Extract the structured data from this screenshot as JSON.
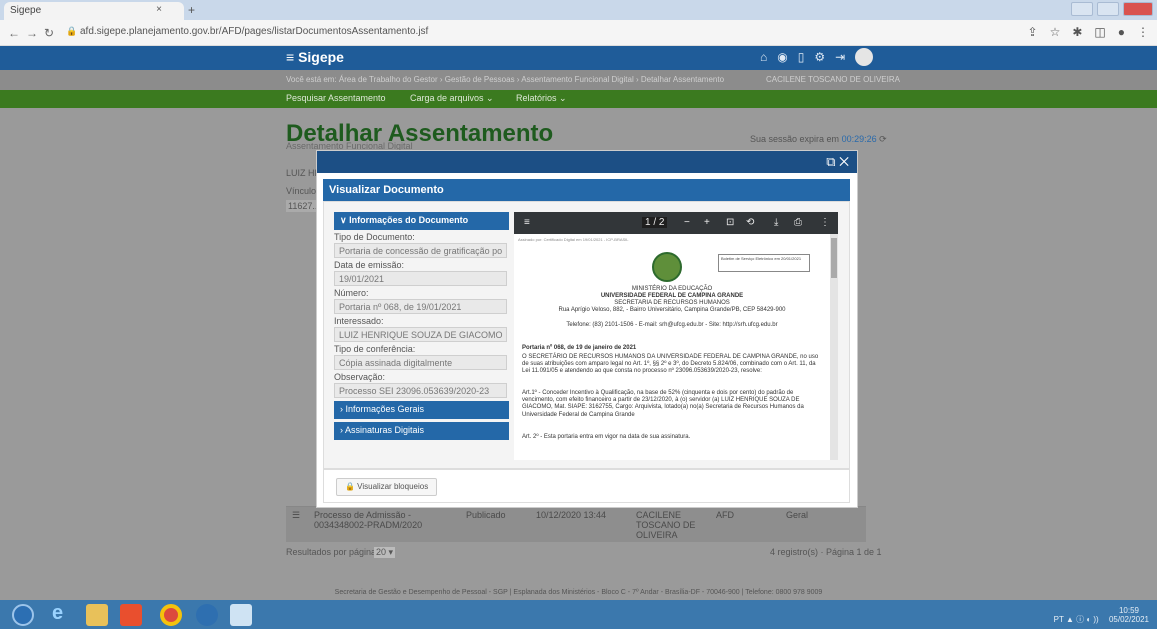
{
  "browser": {
    "tab_title": "Sigepe",
    "tab_close": "×",
    "new_tab": "+",
    "url": "afd.sigepe.planejamento.gov.br/AFD/pages/listarDocumentosAssentamento.jsf"
  },
  "app": {
    "logo": "Sigepe",
    "breadcrumb": "Você está em: Área de Trabalho do Gestor › Gestão de Pessoas › Assentamento Funcional Digital › Detalhar Assentamento",
    "user": "CACILENE TOSCANO DE OLIVEIRA",
    "menu": [
      "Pesquisar Assentamento",
      "Carga de arquivos ⌄",
      "Relatórios ⌄"
    ],
    "page_title": "Detalhar Assentamento",
    "page_sub": "Assentamento Funcional Digital",
    "session_prefix": "Sua sessão expira em",
    "session_time": "00:29:26",
    "bg_name": "LUIZ HE...",
    "bg_vinculo": "Vínculo",
    "bg_vinculo_val": "11627..",
    "bg_row": {
      "doc": "Processo de Admissão - 0034348002-PRADM/2020",
      "status": "Publicado",
      "datetime": "10/12/2020 13:44",
      "user": "CACILENE TOSCANO DE OLIVEIRA",
      "type": "AFD",
      "scope": "Geral"
    },
    "results_label": "Resultados por página:",
    "results_value": "20 ▾",
    "pagination": "4 registro(s) · Página 1 de 1",
    "footer": "Secretaria de Gestão e Desempenho de Pessoal - SGP | Esplanada dos Ministérios - Bloco C - 7º Andar - Brasília-DF - 70046-900 | Telefone: 0800 978 9009"
  },
  "modal": {
    "title": "Visualizar Documento",
    "controls": "⧉ ✕",
    "info_header": "∨ Informações do Documento",
    "fields": [
      {
        "label": "Tipo de Documento:",
        "value": "Portaria de concessão de gratificação po"
      },
      {
        "label": "Data de emissão:",
        "value": "19/01/2021"
      },
      {
        "label": "Número:",
        "value": "Portaria nº 068, de 19/01/2021"
      },
      {
        "label": "Interessado:",
        "value": "LUIZ HENRIQUE SOUZA DE GIACOMO"
      },
      {
        "label": "Tipo de conferência:",
        "value": "Cópia assinada digitalmente"
      },
      {
        "label": "Observação:",
        "value": "Processo SEI 23096.053639/2020-23"
      }
    ],
    "section_general": "› Informações Gerais",
    "section_signatures": "› Assinaturas Digitais",
    "view_locks": "🔒 Visualizar bloqueios"
  },
  "pdf": {
    "menu": "≡",
    "page_indicator": "1 / 2",
    "zoom_out": "−",
    "zoom_in": "+",
    "fit": "⊡",
    "rotate": "⟲",
    "download": "⤓",
    "print": "⎙",
    "more": "⋮",
    "header_line": "Assinado por: Certificado Digital em 19/01/2021 - ICP-BRASIL",
    "stamp": "Boletim de Serviço Eletrônico em 20/01/2021",
    "ministry": "MINISTÉRIO DA EDUCAÇÃO",
    "university": "UNIVERSIDADE FEDERAL DE CAMPINA GRANDE",
    "secretariat": "SECRETARIA DE RECURSOS HUMANOS",
    "address": "Rua Aprígio Veloso, 882, - Bairro Universitário, Campina Grande/PB, CEP 58429-900",
    "contact": "Telefone: (83) 2101-1506 - E-mail: srh@ufcg.edu.br - Site: http://srh.ufcg.edu.br",
    "doc_title": "Portaria nº 068, de 19 de janeiro de 2021",
    "body1": "O SECRETÁRIO DE RECURSOS HUMANOS DA UNIVERSIDADE FEDERAL DE CAMPINA GRANDE, no uso de suas atribuições com amparo legal no Art. 1º, §§ 2º e 3º, do Decreto 5.824/06, combinado com o Art. 11, da Lei 11.091/05 e atendendo ao que consta no processo nº 23096.053639/2020-23, resolve:",
    "body2": "Art.1º - Conceder Incentivo à Qualificação, na base de 52% (cinquenta e dois por cento) do padrão de vencimento, com efeito financeiro a partir de 23/12/2020, à (o) servidor (a) LUIZ HENRIQUE SOUZA DE GIACOMO, Mat. SIAPE: 3162755, Cargo: Arquivista, lotado(a) no(a) Secretaria de Recursos Humanos da Universidade Federal de Campina Grande",
    "body3": "Art. 2º - Esta portaria entra em vigor na data de sua assinatura."
  },
  "taskbar": {
    "time": "10:59",
    "date": "05/02/2021",
    "tray": "PT ▲ ⓘ ◐ ))"
  }
}
